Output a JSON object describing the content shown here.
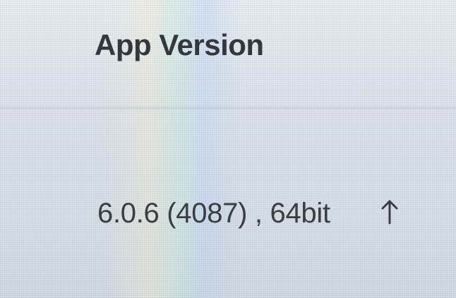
{
  "section": {
    "title": "App Version"
  },
  "version": {
    "value": "6.0.6 (4087) , 64bit",
    "update_icon": "arrow-up-icon"
  }
}
